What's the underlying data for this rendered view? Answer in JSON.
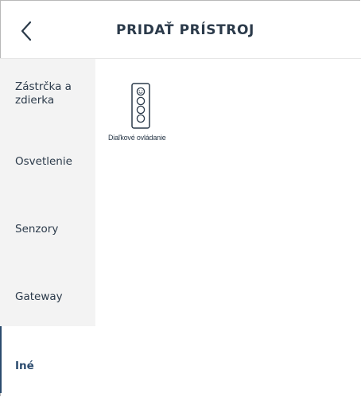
{
  "header": {
    "title": "PRIDAŤ PRÍSTROJ",
    "back_icon": "chevron-left-icon"
  },
  "sidebar": {
    "items": [
      {
        "label": "Zástrčka a\nzdierka",
        "active": false
      },
      {
        "label": "Osvetlenie",
        "active": false
      },
      {
        "label": "Senzory",
        "active": false
      },
      {
        "label": "Gateway",
        "active": false
      },
      {
        "label": "Iné",
        "active": true
      }
    ]
  },
  "devices": [
    {
      "label": "Diaľkové ovládanie",
      "icon": "remote-control-icon"
    }
  ],
  "colors": {
    "text": "#2b3a4a",
    "accent": "#2b4b6e",
    "sidebar_bg": "#f3f3f3"
  }
}
